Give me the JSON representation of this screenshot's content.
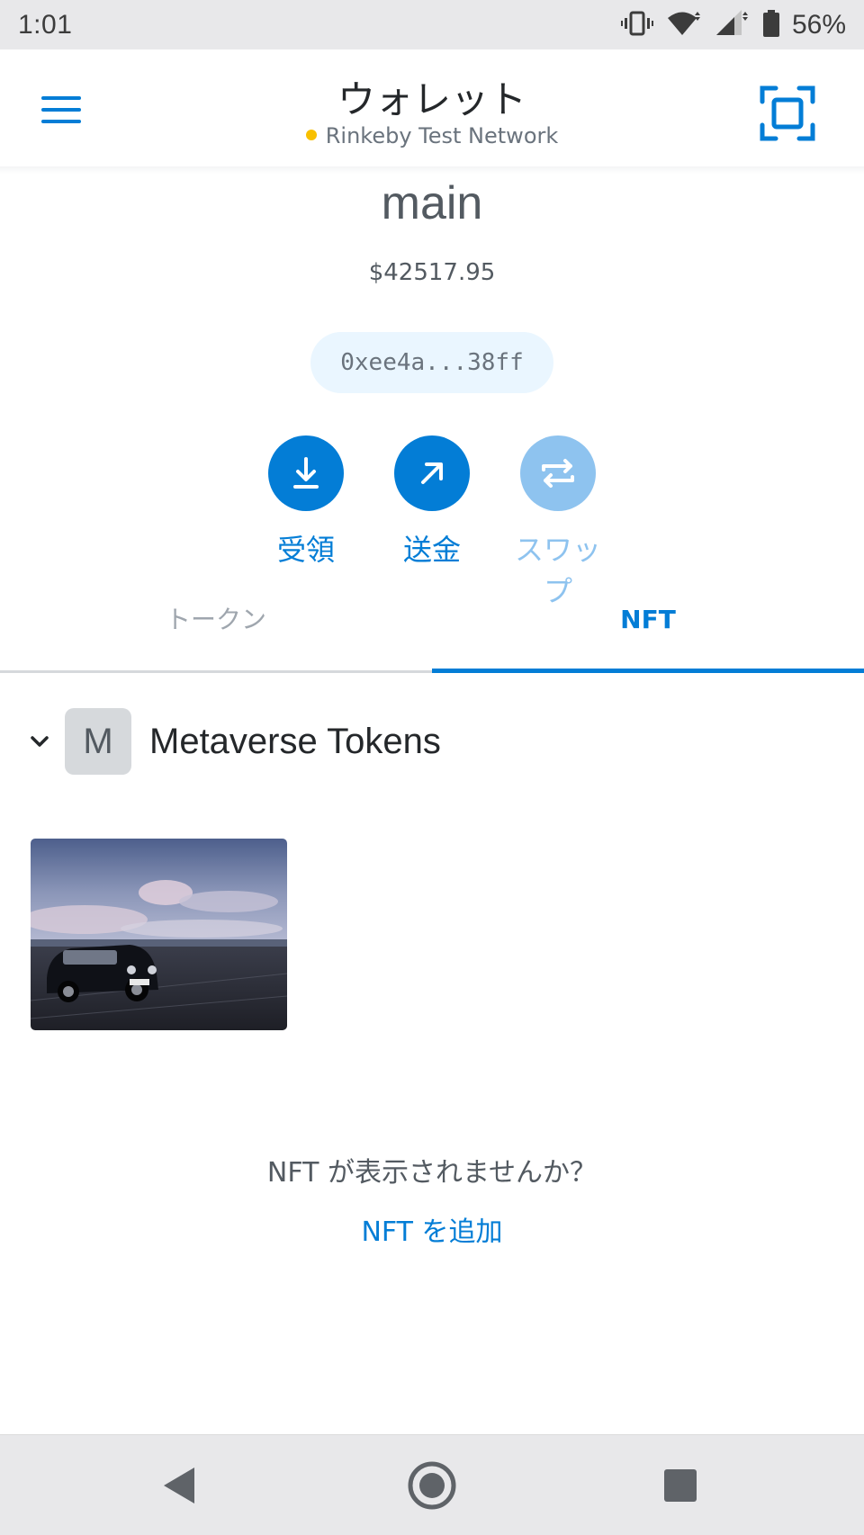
{
  "status_bar": {
    "time": "1:01",
    "battery_percent": "56%",
    "icons": [
      "vibrate-icon",
      "wifi-icon",
      "signal-icon",
      "battery-icon"
    ]
  },
  "header": {
    "title": "ウォレット",
    "network": "Rinkeby Test Network",
    "network_dot_color": "#f8c000",
    "menu_icon": "hamburger-menu-icon",
    "scan_icon": "qr-scan-icon"
  },
  "account": {
    "name": "main",
    "balance": "$42517.95",
    "address": "0xee4a...38ff"
  },
  "actions": [
    {
      "label": "受領",
      "icon": "download-arrow-icon",
      "enabled": true
    },
    {
      "label": "送金",
      "icon": "send-arrow-icon",
      "enabled": true
    },
    {
      "label": "スワップ",
      "icon": "swap-icon",
      "enabled": false
    }
  ],
  "tabs": [
    {
      "label": "トークン",
      "active": false
    },
    {
      "label": "NFT",
      "active": true
    }
  ],
  "collection": {
    "avatar_letter": "M",
    "name": "Metaverse Tokens",
    "expanded": true
  },
  "nft_items": [
    {
      "description_icon": "car-photo-thumbnail"
    }
  ],
  "footer": {
    "prompt": "NFT が表示されませんか？",
    "add_link": "NFT を追加"
  },
  "colors": {
    "accent": "#037dd6",
    "accent_disabled": "#8ec3ef",
    "address_pill_bg": "#eaf6ff"
  },
  "nav_bar": {
    "buttons": [
      "back-icon",
      "home-icon",
      "recents-icon"
    ]
  }
}
